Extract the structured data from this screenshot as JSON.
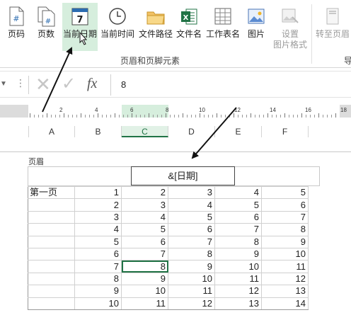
{
  "ribbon": {
    "buttons": [
      {
        "label": "页码",
        "icon": "page-number-icon"
      },
      {
        "label": "页数",
        "icon": "page-count-icon"
      },
      {
        "label": "当前日期",
        "icon": "calendar-icon"
      },
      {
        "label": "当前时间",
        "icon": "clock-icon"
      },
      {
        "label": "文件路径",
        "icon": "folder-icon"
      },
      {
        "label": "文件名",
        "icon": "excel-file-icon"
      },
      {
        "label": "工作表名",
        "icon": "sheet-icon"
      },
      {
        "label": "图片",
        "icon": "picture-icon"
      },
      {
        "label": "设置",
        "label2": "图片格式",
        "icon": "picture-format-icon"
      },
      {
        "label": "转至页眉",
        "icon": "goto-header-icon"
      },
      {
        "label": "导",
        "icon": ""
      }
    ],
    "group_label": "页眉和页脚元素",
    "calendar_glyph": "7"
  },
  "formula_bar": {
    "value": "8",
    "fx": "fx",
    "cancel": "✕",
    "enter": "✓"
  },
  "ruler": {
    "numbers": [
      "2",
      "4",
      "6",
      "8",
      "10",
      "12",
      "14",
      "16",
      "18"
    ]
  },
  "columns": [
    "A",
    "B",
    "C",
    "D",
    "E",
    "F"
  ],
  "selected_column": "C",
  "header": {
    "label": "页眉",
    "center_text": "&[日期]"
  },
  "grid": {
    "first_label": "第一页",
    "rows": [
      [
        "1",
        "2",
        "3",
        "4",
        "5"
      ],
      [
        "2",
        "3",
        "4",
        "5",
        "6"
      ],
      [
        "3",
        "4",
        "5",
        "6",
        "7"
      ],
      [
        "4",
        "5",
        "6",
        "7",
        "8"
      ],
      [
        "5",
        "6",
        "7",
        "8",
        "9"
      ],
      [
        "6",
        "7",
        "8",
        "9",
        "10"
      ],
      [
        "7",
        "8",
        "9",
        "10",
        "11"
      ],
      [
        "8",
        "9",
        "10",
        "11",
        "12"
      ],
      [
        "9",
        "10",
        "11",
        "12",
        "13"
      ],
      [
        "10",
        "11",
        "12",
        "13",
        "14"
      ]
    ],
    "selected_cell": {
      "row": 6,
      "col": 1
    }
  },
  "colors": {
    "accent": "#217346",
    "selected_bg": "#d6eedd"
  }
}
